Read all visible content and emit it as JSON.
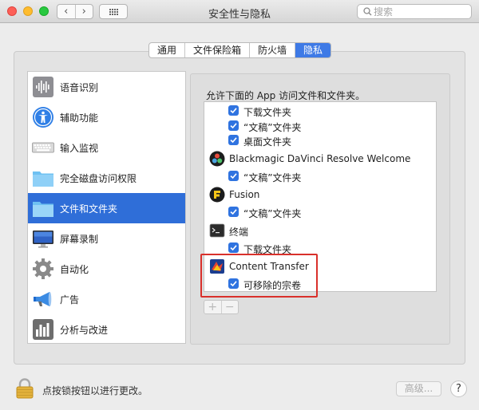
{
  "window": {
    "title": "安全性与隐私",
    "nav_back": "‹",
    "nav_forward": "›",
    "search_placeholder": "搜索"
  },
  "tabs": [
    {
      "label": "通用",
      "active": false
    },
    {
      "label": "文件保险箱",
      "active": false
    },
    {
      "label": "防火墙",
      "active": false
    },
    {
      "label": "隐私",
      "active": true
    }
  ],
  "sidebar": {
    "items": [
      {
        "label": "语音识别",
        "icon": "voice-waveform-icon"
      },
      {
        "label": "辅助功能",
        "icon": "accessibility-icon"
      },
      {
        "label": "输入监视",
        "icon": "keyboard-icon"
      },
      {
        "label": "完全磁盘访问权限",
        "icon": "folder-icon"
      },
      {
        "label": "文件和文件夹",
        "icon": "folder-icon",
        "selected": true
      },
      {
        "label": "屏幕录制",
        "icon": "display-icon"
      },
      {
        "label": "自动化",
        "icon": "gear-icon"
      },
      {
        "label": "广告",
        "icon": "megaphone-icon"
      },
      {
        "label": "分析与改进",
        "icon": "bar-chart-icon"
      }
    ]
  },
  "main": {
    "heading": "允许下面的 App 访问文件和文件夹。",
    "rows": [
      {
        "type": "permission",
        "label": "下载文件夹",
        "checked": true
      },
      {
        "type": "permission",
        "label": "“文稿”文件夹",
        "checked": true
      },
      {
        "type": "permission",
        "label": "桌面文件夹",
        "checked": true
      },
      {
        "type": "app",
        "label": "Blackmagic DaVinci Resolve Welcome",
        "icon": "davinci-resolve-icon"
      },
      {
        "type": "permission",
        "label": "“文稿”文件夹",
        "checked": true
      },
      {
        "type": "app",
        "label": "Fusion",
        "icon": "fusion-icon"
      },
      {
        "type": "permission",
        "label": "“文稿”文件夹",
        "checked": true
      },
      {
        "type": "app",
        "label": "终端",
        "icon": "terminal-icon"
      },
      {
        "type": "permission",
        "label": "下载文件夹",
        "checked": true
      },
      {
        "type": "app",
        "label": "Content Transfer",
        "icon": "content-transfer-icon"
      },
      {
        "type": "permission",
        "label": "可移除的宗卷",
        "checked": true
      }
    ],
    "add_label": "+",
    "remove_label": "−"
  },
  "footer": {
    "lock_text": "点按锁按钮以进行更改。",
    "advanced_label": "高级...",
    "help_label": "?"
  },
  "colors": {
    "accent": "#2f6ed8",
    "checkbox": "#2f73e0",
    "highlight": "#d9302b"
  }
}
